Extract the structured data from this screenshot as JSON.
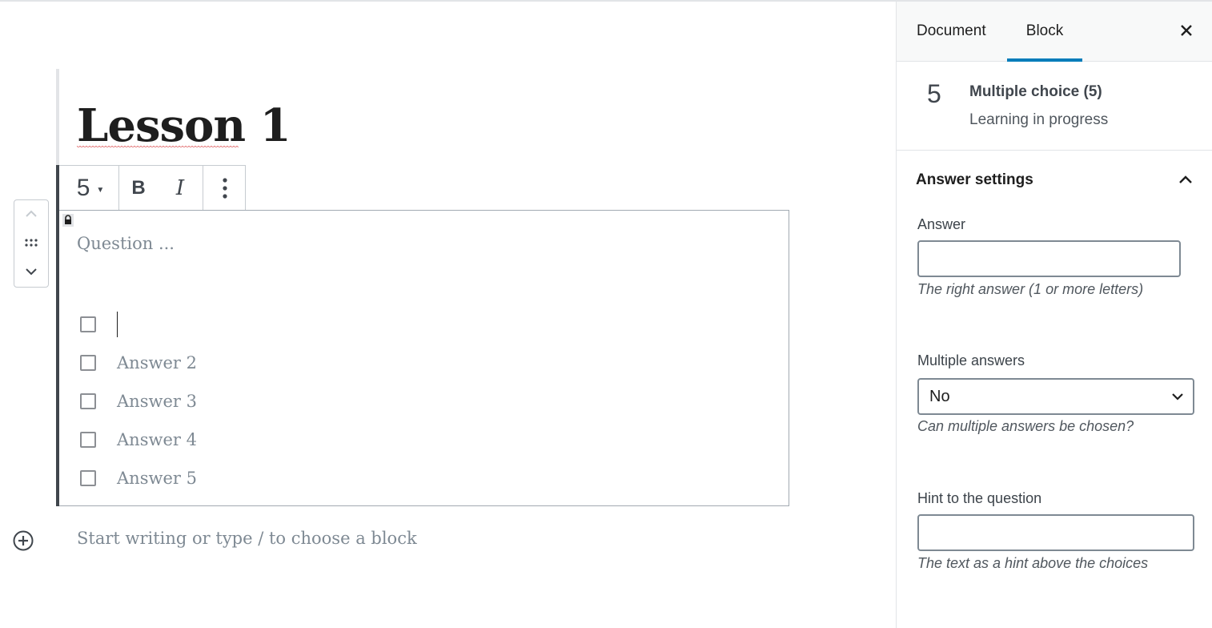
{
  "editor": {
    "post_title": "Lesson 1",
    "toolbar": {
      "heading_level": "5",
      "bold_label": "B",
      "italic_label": "I"
    },
    "question_block": {
      "question_placeholder": "Question ...",
      "answers": [
        {
          "text": ""
        },
        {
          "text": "Answer 2"
        },
        {
          "text": "Answer 3"
        },
        {
          "text": "Answer 4"
        },
        {
          "text": "Answer 5"
        }
      ]
    },
    "appender_placeholder": "Start writing or type / to choose a block"
  },
  "sidebar": {
    "tabs": [
      {
        "label": "Document",
        "active": false
      },
      {
        "label": "Block",
        "active": true
      }
    ],
    "block_card": {
      "icon_text": "5",
      "title": "Multiple choice (5)",
      "description": "Learning in progress"
    },
    "panel": {
      "title": "Answer settings",
      "expanded": true,
      "answer": {
        "label": "Answer",
        "value": "",
        "help": "The right answer (1 or more letters)"
      },
      "multiple": {
        "label": "Multiple answers",
        "value": "No",
        "help": "Can multiple answers be chosen?"
      },
      "hint": {
        "label": "Hint to the question",
        "value": "",
        "help": "The text as a hint above the choices"
      }
    }
  },
  "colors": {
    "accent": "#007cba",
    "text": "#1e1e1e",
    "placeholder": "#7e8993",
    "border": "#e2e4e7"
  }
}
